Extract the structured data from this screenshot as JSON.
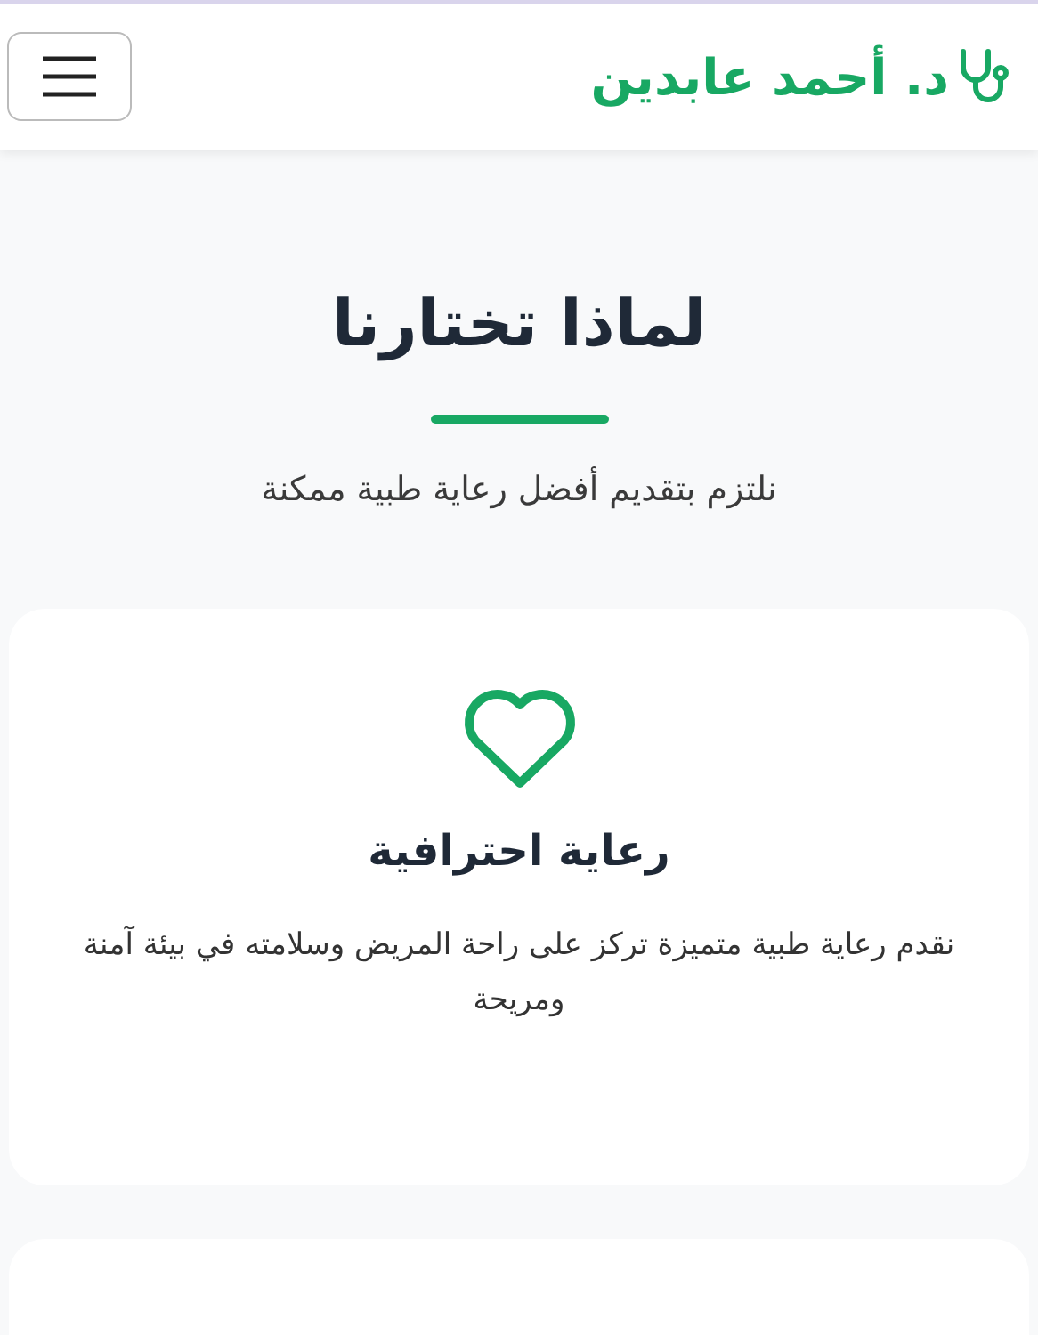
{
  "header": {
    "brand": "د. أحمد عابدين"
  },
  "section": {
    "title": "لماذا تختارنا",
    "subtitle": "نلتزم بتقديم أفضل رعاية طبية ممكنة"
  },
  "cards": [
    {
      "title": "رعاية احترافية",
      "text": "نقدم رعاية طبية متميزة تركز على راحة المريض وسلامته في بيئة آمنة ومريحة"
    }
  ]
}
